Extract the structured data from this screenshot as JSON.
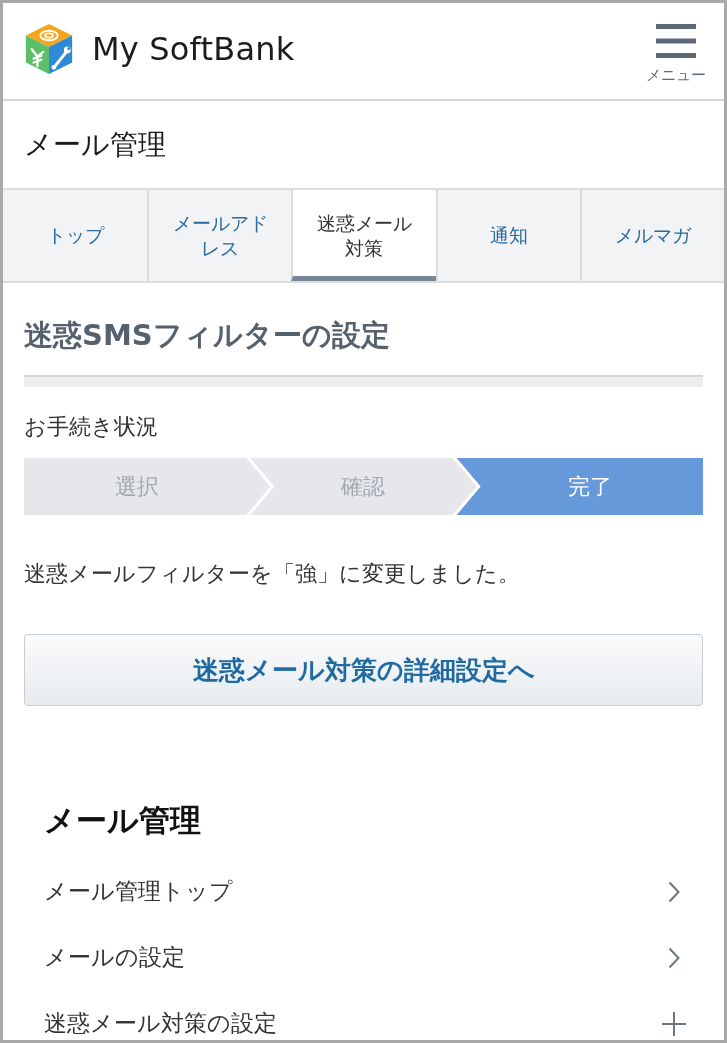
{
  "header": {
    "brand": "My SoftBank",
    "menu_label": "メニュー"
  },
  "page_title": "メール管理",
  "tabs": [
    {
      "label": "トップ",
      "selected": false
    },
    {
      "label": "メールアドレス",
      "selected": false
    },
    {
      "label": "迷惑メール対策",
      "selected": true
    },
    {
      "label": "通知",
      "selected": false
    },
    {
      "label": "メルマガ",
      "selected": false
    }
  ],
  "section": {
    "heading": "迷惑SMSフィルターの設定",
    "progress_label": "お手続き状況",
    "steps": [
      {
        "label": "選択",
        "selected": false
      },
      {
        "label": "確認",
        "selected": false
      },
      {
        "label": "完了",
        "selected": true
      }
    ],
    "message": "迷惑メールフィルターを「強」に変更しました。",
    "button": "迷惑メール対策の詳細設定へ"
  },
  "nav": {
    "heading": "メール管理",
    "items": [
      {
        "label": "メール管理トップ",
        "kind": "link"
      },
      {
        "label": "メールの設定",
        "kind": "link"
      },
      {
        "label": "迷惑メール対策の設定",
        "kind": "expand"
      }
    ]
  }
}
